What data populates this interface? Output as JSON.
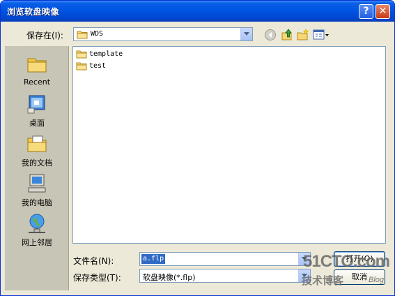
{
  "window": {
    "title": "浏览软盘映像",
    "help_button": "?",
    "close_button": "✕"
  },
  "toolbar": {
    "save_in_label": "保存在(I):",
    "location": "WDS",
    "icons": [
      "back-icon",
      "up-folder-icon",
      "new-folder-icon",
      "views-menu-icon"
    ]
  },
  "places": [
    {
      "label": "Recent",
      "icon": "recent-folder-icon"
    },
    {
      "label": "桌面",
      "icon": "desktop-icon"
    },
    {
      "label": "我的文档",
      "icon": "my-documents-icon"
    },
    {
      "label": "我的电脑",
      "icon": "my-computer-icon"
    },
    {
      "label": "网上邻居",
      "icon": "network-places-icon"
    }
  ],
  "files": [
    {
      "name": "template",
      "icon": "folder-icon"
    },
    {
      "name": "test",
      "icon": "folder-icon"
    }
  ],
  "form": {
    "file_name_label": "文件名(N):",
    "file_name_value": "a.flp",
    "file_type_label": "保存类型(T):",
    "file_type_value": "软盘映像(*.flp)",
    "open_button": "打开(O)",
    "cancel_button": "取消"
  },
  "watermark": {
    "site": "51CTO.com",
    "tagline": "技术博客",
    "blog": "Blog"
  },
  "colors": {
    "titlebar": "#0054e3",
    "dialog_bg": "#ece9d8",
    "places_bg": "#c7c5b5",
    "selection": "#316ac5"
  }
}
